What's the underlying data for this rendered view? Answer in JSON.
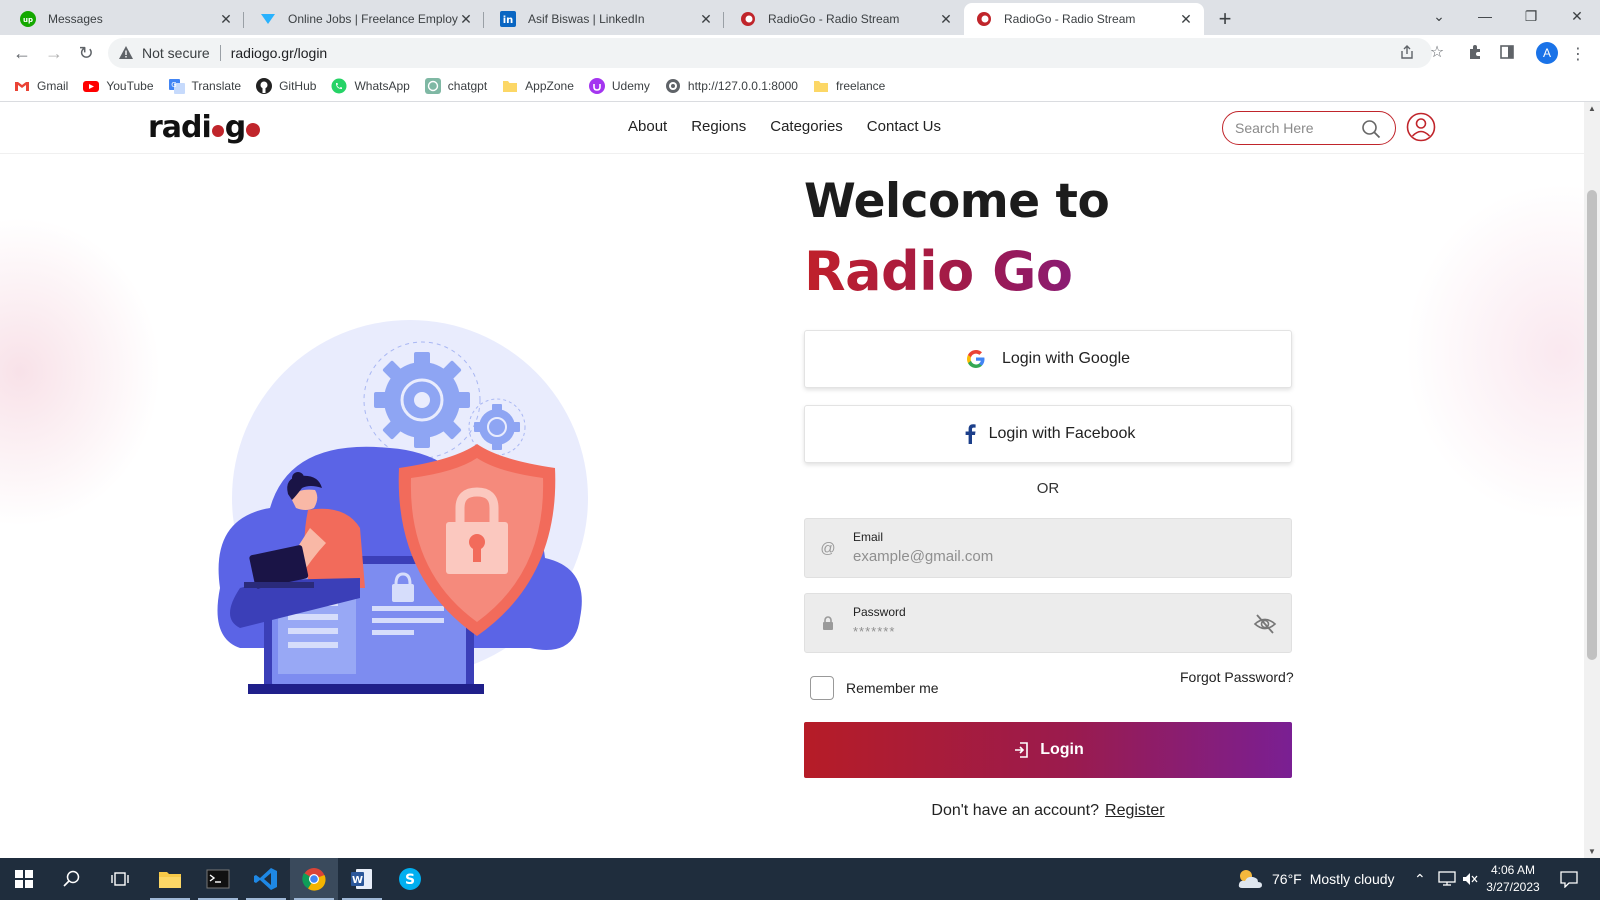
{
  "browser": {
    "tabs": [
      {
        "title": "Messages",
        "favicon": "upwork-icon"
      },
      {
        "title": "Online Jobs | Freelance Employm",
        "favicon": "freelancer-icon"
      },
      {
        "title": "Asif Biswas | LinkedIn",
        "favicon": "linkedin-icon"
      },
      {
        "title": "RadioGo - Radio Stream",
        "favicon": "radiogo-icon"
      },
      {
        "title": "RadioGo - Radio Stream",
        "favicon": "radiogo-icon",
        "active": true
      }
    ],
    "security_label": "Not secure",
    "url": "radiogo.gr/login",
    "profile_initial": "A",
    "bookmarks": [
      {
        "label": "Gmail",
        "icon": "gmail-icon"
      },
      {
        "label": "YouTube",
        "icon": "youtube-icon"
      },
      {
        "label": "Translate",
        "icon": "translate-icon"
      },
      {
        "label": "GitHub",
        "icon": "github-icon"
      },
      {
        "label": "WhatsApp",
        "icon": "whatsapp-icon"
      },
      {
        "label": "chatgpt",
        "icon": "chatgpt-icon"
      },
      {
        "label": "AppZone",
        "icon": "folder-icon"
      },
      {
        "label": "Udemy",
        "icon": "udemy-icon"
      },
      {
        "label": "http://127.0.0.1:8000",
        "icon": "globe-icon"
      },
      {
        "label": "freelance",
        "icon": "folder-icon"
      }
    ]
  },
  "site": {
    "logo_text_a": "radi",
    "logo_text_b": "g",
    "nav": [
      "About",
      "Regions",
      "Categories",
      "Contact Us"
    ],
    "search_placeholder": "Search Here"
  },
  "login": {
    "welcome": "Welcome to",
    "brand": "Radio Go",
    "google_label": "Login with Google",
    "facebook_label": "Login with Facebook",
    "or_label": "OR",
    "email_label": "Email",
    "email_placeholder": "example@gmail.com",
    "password_label": "Password",
    "password_placeholder": "*******",
    "remember_label": "Remember me",
    "forgot_label": "Forgot Password?",
    "login_label": "Login",
    "no_account": "Don't have an account?",
    "register_label": "Register"
  },
  "taskbar": {
    "weather_temp": "76°F",
    "weather_desc": "Mostly cloudy",
    "time": "4:06 AM",
    "date": "3/27/2023"
  },
  "colors": {
    "brand_red": "#c0252b",
    "brand_purple": "#7a1f93",
    "illustration_blue": "#5b6cf0",
    "shield_coral": "#f26b5b"
  }
}
